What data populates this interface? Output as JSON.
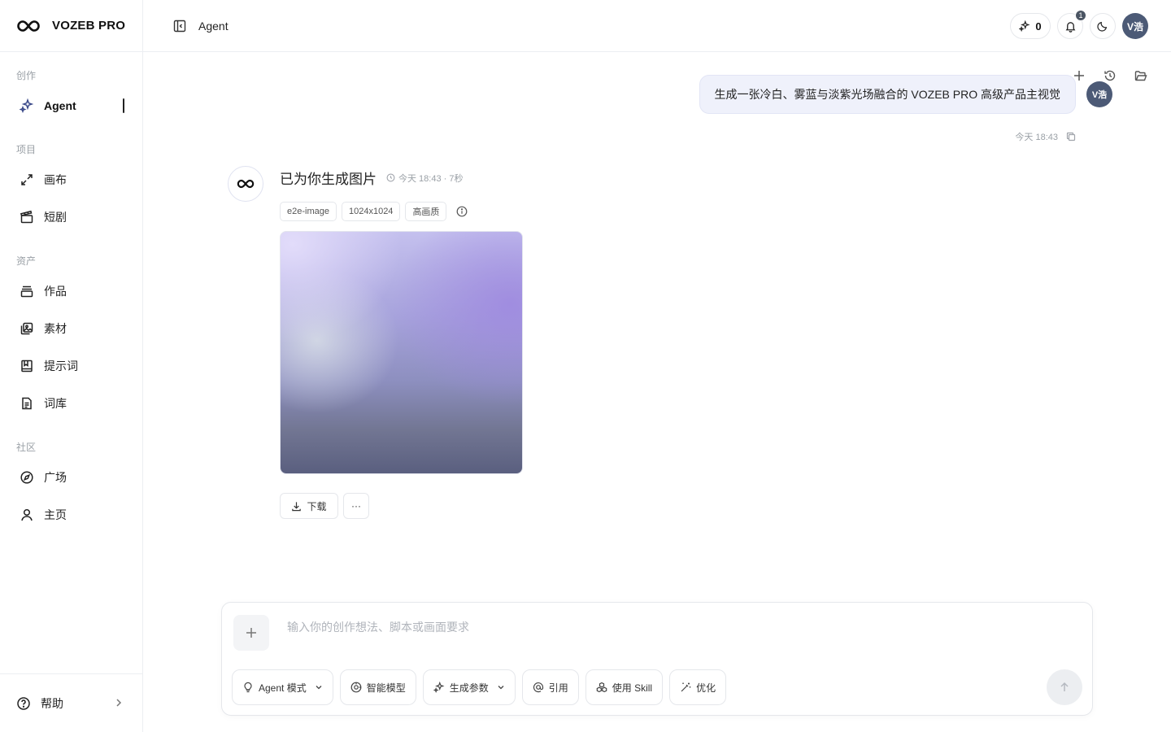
{
  "brand": {
    "name": "VOZEB PRO"
  },
  "sidebar": {
    "sections": [
      {
        "label": "创作",
        "items": [
          {
            "label": "Agent",
            "icon": "sparkles-icon",
            "active": true
          }
        ]
      },
      {
        "label": "项目",
        "items": [
          {
            "label": "画布",
            "icon": "expand-icon"
          },
          {
            "label": "短剧",
            "icon": "clapperboard-icon"
          }
        ]
      },
      {
        "label": "资产",
        "items": [
          {
            "label": "作品",
            "icon": "layers-icon"
          },
          {
            "label": "素材",
            "icon": "image-gallery-icon"
          },
          {
            "label": "提示词",
            "icon": "bookmark-book-icon"
          },
          {
            "label": "词库",
            "icon": "document-icon"
          }
        ]
      },
      {
        "label": "社区",
        "items": [
          {
            "label": "广场",
            "icon": "compass-icon"
          },
          {
            "label": "主页",
            "icon": "user-icon"
          }
        ]
      }
    ],
    "help_label": "帮助"
  },
  "header": {
    "title": "Agent",
    "credits": "0",
    "notification_count": "1",
    "avatar_text": "V浩"
  },
  "chat": {
    "user_message": "生成一张冷白、雾蓝与淡紫光场融合的 VOZEB PRO 高级产品主视觉",
    "user_avatar_text": "V浩",
    "user_time": "今天 18:43",
    "bot_title": "已为你生成图片",
    "bot_meta": "今天 18:43 · 7秒",
    "tags": [
      "e2e-image",
      "1024x1024",
      "高画质"
    ],
    "download_label": "下载",
    "more_label": "···"
  },
  "composer": {
    "placeholder": "输入你的创作想法、脚本或画面要求",
    "buttons": {
      "agent_mode": "Agent 模式",
      "model": "智能模型",
      "params": "生成参数",
      "reference": "引用",
      "skill": "使用 Skill",
      "optimize": "优化"
    }
  },
  "colors": {
    "accent": "#4c5a76",
    "bubble": "#eff1fb",
    "border": "#e5e7eb"
  }
}
